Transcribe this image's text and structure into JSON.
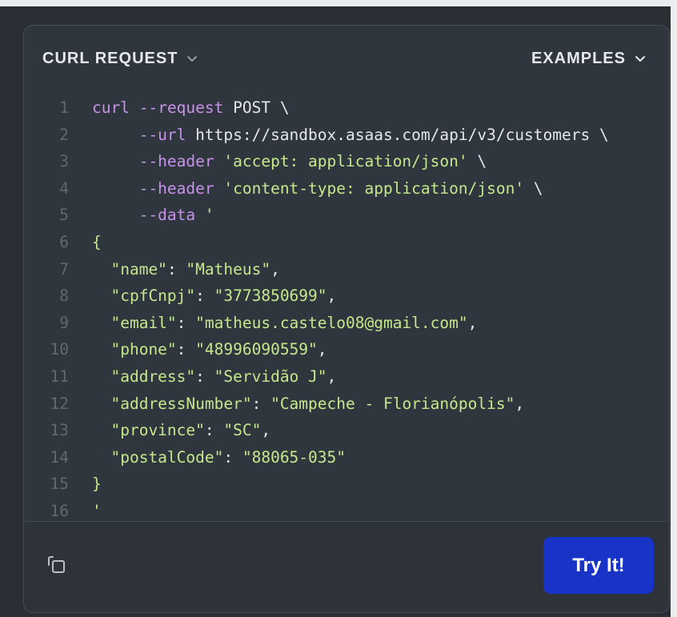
{
  "header": {
    "left_label": "CURL REQUEST",
    "right_label": "EXAMPLES"
  },
  "code": {
    "lines": [
      {
        "n": "1",
        "text": "curl --request POST \\"
      },
      {
        "n": "2",
        "text": "     --url https://sandbox.asaas.com/api/v3/customers \\"
      },
      {
        "n": "3",
        "text": "     --header 'accept: application/json' \\"
      },
      {
        "n": "4",
        "text": "     --header 'content-type: application/json' \\"
      },
      {
        "n": "5",
        "text": "     --data '"
      },
      {
        "n": "6",
        "text": "{"
      },
      {
        "n": "7",
        "text": "  \"name\": \"Matheus\","
      },
      {
        "n": "8",
        "text": "  \"cpfCnpj\": \"3773850699\","
      },
      {
        "n": "9",
        "text": "  \"email\": \"matheus.castelo08@gmail.com\","
      },
      {
        "n": "10",
        "text": "  \"phone\": \"48996090559\","
      },
      {
        "n": "11",
        "text": "  \"address\": \"Servidão J\","
      },
      {
        "n": "12",
        "text": "  \"addressNumber\": \"Campeche - Florianópolis\","
      },
      {
        "n": "13",
        "text": "  \"province\": \"SC\","
      },
      {
        "n": "14",
        "text": "  \"postalCode\": \"88065-035\""
      },
      {
        "n": "15",
        "text": "}"
      },
      {
        "n": "16",
        "text": "'"
      }
    ]
  },
  "footer": {
    "copy_icon": "copy-icon",
    "try_label": "Try It!"
  },
  "colors": {
    "background": "#30363d",
    "keyword": "#c792ea",
    "string": "#c3e88d",
    "text": "#e5e7ea",
    "line_number": "#5f6873",
    "accent_button": "#1834c6"
  }
}
